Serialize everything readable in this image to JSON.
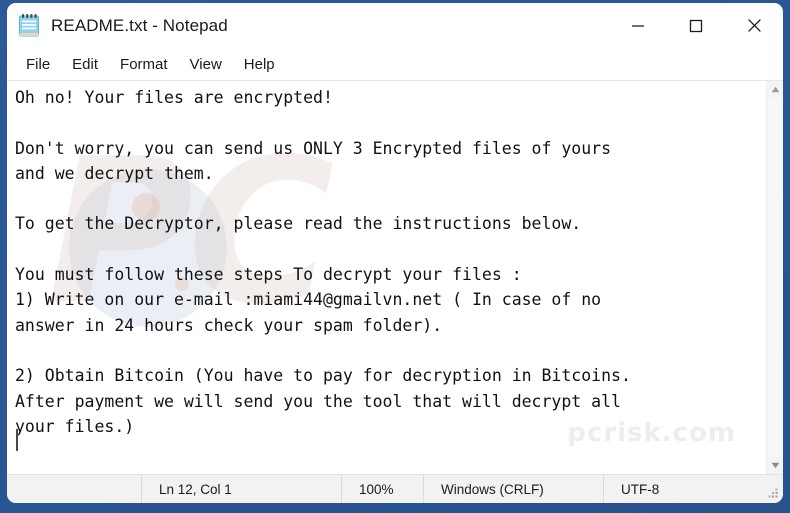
{
  "window": {
    "title": "README.txt - Notepad",
    "icon": "notepad-icon",
    "controls": {
      "minimize": "Minimize",
      "maximize": "Maximize",
      "close": "Close"
    }
  },
  "menubar": {
    "items": [
      {
        "label": "File"
      },
      {
        "label": "Edit"
      },
      {
        "label": "Format"
      },
      {
        "label": "View"
      },
      {
        "label": "Help"
      }
    ]
  },
  "document": {
    "filename": "README.txt",
    "lines": [
      "Oh no! Your files are encrypted!",
      "",
      "Don't worry, you can send us ONLY 3 Encrypted files of yours",
      "and we decrypt them.",
      "",
      "To get the Decryptor, please read the instructions below.",
      "",
      "You must follow these steps To decrypt your files :",
      "1) Write on our e-mail :miami44@gmailvn.net ( In case of no",
      "answer in 24 hours check your spam folder).",
      "",
      "2) Obtain Bitcoin (You have to pay for decryption in Bitcoins.",
      "After payment we will send you the tool that will decrypt all",
      "your files.)"
    ],
    "text": "Oh no! Your files are encrypted!\n\nDon't worry, you can send us ONLY 3 Encrypted files of yours\nand we decrypt them.\n\nTo get the Decryptor, please read the instructions below.\n\nYou must follow these steps To decrypt your files :\n1) Write on our e-mail :miami44@gmailvn.net ( In case of no\nanswer in 24 hours check your spam folder).\n\n2) Obtain Bitcoin (You have to pay for decryption in Bitcoins.\nAfter payment we will send you the tool that will decrypt all\nyour files.)",
    "contact_email": "miami44@gmailvn.net",
    "encrypted_files_allowed": "3",
    "response_window_hours": "24"
  },
  "watermark": {
    "main": "PC",
    "sub": "pcrisk.com"
  },
  "statusbar": {
    "cursor_position": "Ln 12, Col 1",
    "zoom": "100%",
    "line_ending": "Windows (CRLF)",
    "encoding": "UTF-8"
  },
  "scrollbar": {
    "up_arrow": "scroll-up-icon",
    "down_arrow": "scroll-down-icon"
  },
  "colors": {
    "desktop_blue": "#2c5998",
    "window_bg": "#ffffff",
    "statusbar_bg": "#f2f2f2",
    "text": "#111111"
  }
}
